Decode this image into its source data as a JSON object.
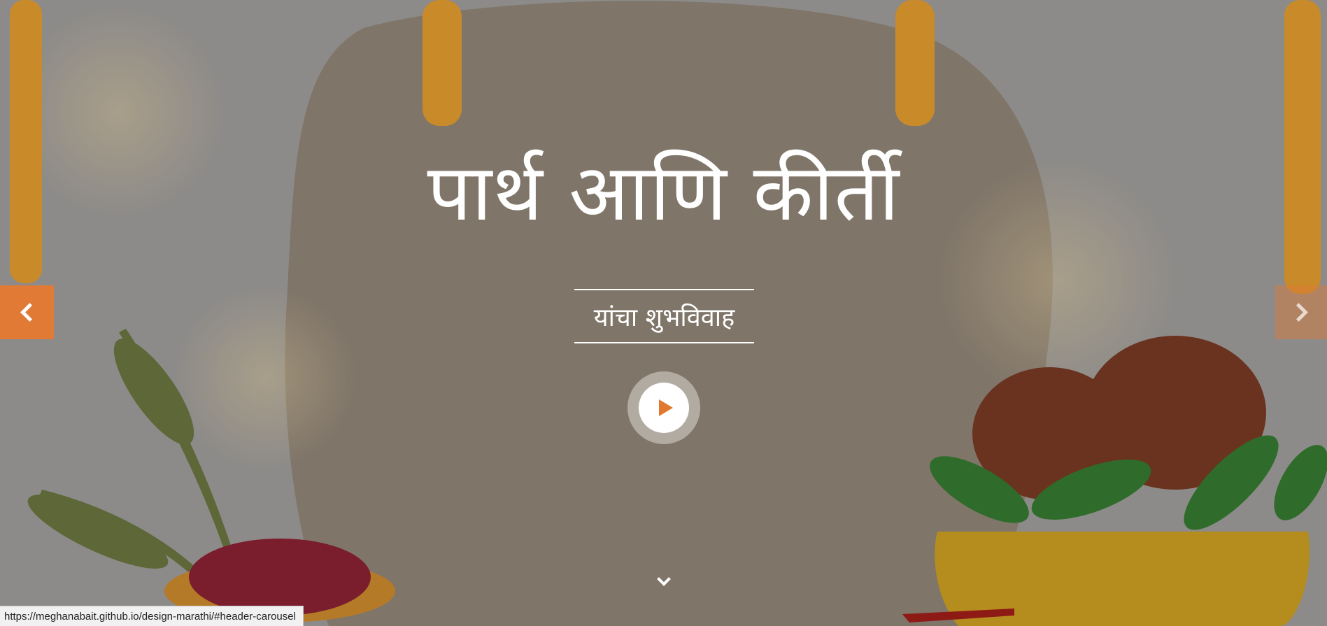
{
  "hero": {
    "title": "पार्थ आणि कीर्ती",
    "subtitle": "यांचा शुभविवाह"
  },
  "controls": {
    "play_icon": "play-icon",
    "prev_icon": "chevron-left-icon",
    "next_icon": "chevron-right-icon",
    "down_icon": "chevron-down-icon"
  },
  "statusbar": {
    "url": "https://meghanabait.github.io/design-marathi/#header-carousel"
  },
  "colors": {
    "accent": "#e07a35",
    "text": "#ffffff"
  }
}
